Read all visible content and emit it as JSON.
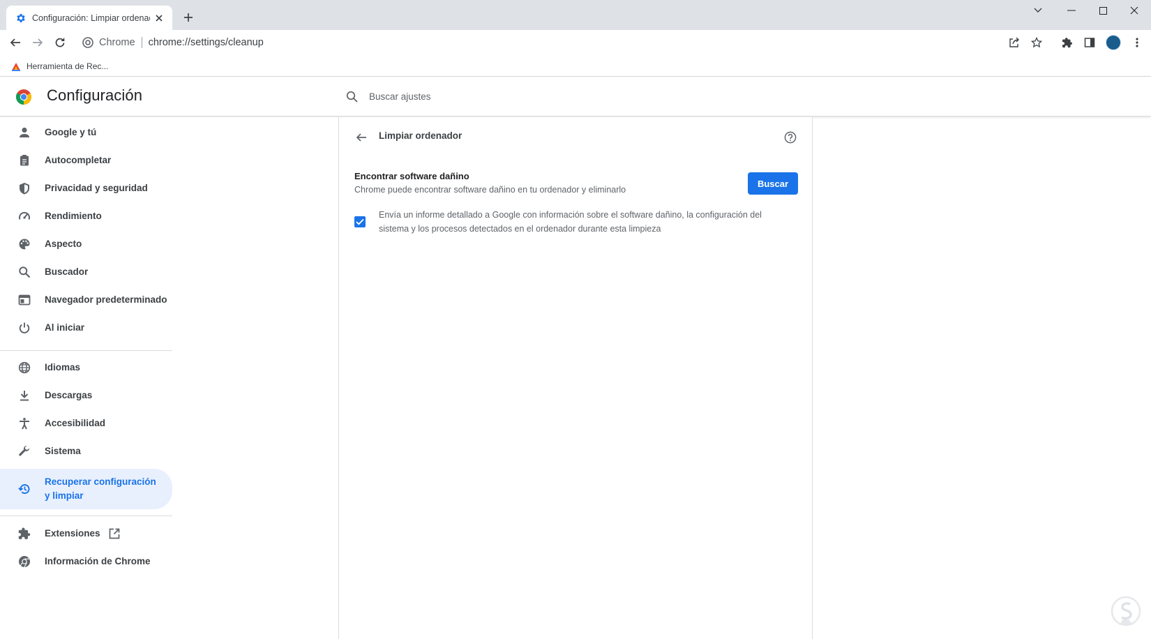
{
  "browser": {
    "tab_title": "Configuración: Limpiar ordenador",
    "omnibox_site": "Chrome",
    "omnibox_url": "chrome://settings/cleanup",
    "bookmark_label": "Herramienta de Rec..."
  },
  "header": {
    "title": "Configuración",
    "search_placeholder": "Buscar ajustes"
  },
  "sidebar": {
    "items": [
      {
        "label": "Google y tú",
        "icon": "person-icon"
      },
      {
        "label": "Autocompletar",
        "icon": "clipboard-icon"
      },
      {
        "label": "Privacidad y seguridad",
        "icon": "shield-icon"
      },
      {
        "label": "Rendimiento",
        "icon": "speedometer-icon"
      },
      {
        "label": "Aspecto",
        "icon": "palette-icon"
      },
      {
        "label": "Buscador",
        "icon": "search-icon"
      },
      {
        "label": "Navegador predeterminado",
        "icon": "browser-window-icon"
      },
      {
        "label": "Al iniciar",
        "icon": "power-icon"
      },
      {
        "label": "Idiomas",
        "icon": "globe-icon"
      },
      {
        "label": "Descargas",
        "icon": "download-icon"
      },
      {
        "label": "Accesibilidad",
        "icon": "accessibility-icon"
      },
      {
        "label": "Sistema",
        "icon": "wrench-icon"
      },
      {
        "label": "Recuperar configuración y limpiar",
        "icon": "restore-icon",
        "active": true
      },
      {
        "label": "Extensiones",
        "icon": "puzzle-icon"
      },
      {
        "label": "Información de Chrome",
        "icon": "chrome-icon"
      }
    ]
  },
  "cleanup": {
    "title": "Limpiar ordenador",
    "row_title": "Encontrar software dañino",
    "row_subtitle": "Chrome puede encontrar software dañino en tu ordenador y eliminarlo",
    "search_button": "Buscar",
    "report_checkbox_checked": true,
    "report_label": "Envía un informe detallado a Google con información sobre el software dañino, la configuración del sistema y los procesos detectados en el ordenador durante esta limpieza"
  },
  "colors": {
    "accent": "#1a73e8",
    "active_nav_bg": "#e8f0fe",
    "tabstrip_bg": "#dee1e6"
  }
}
